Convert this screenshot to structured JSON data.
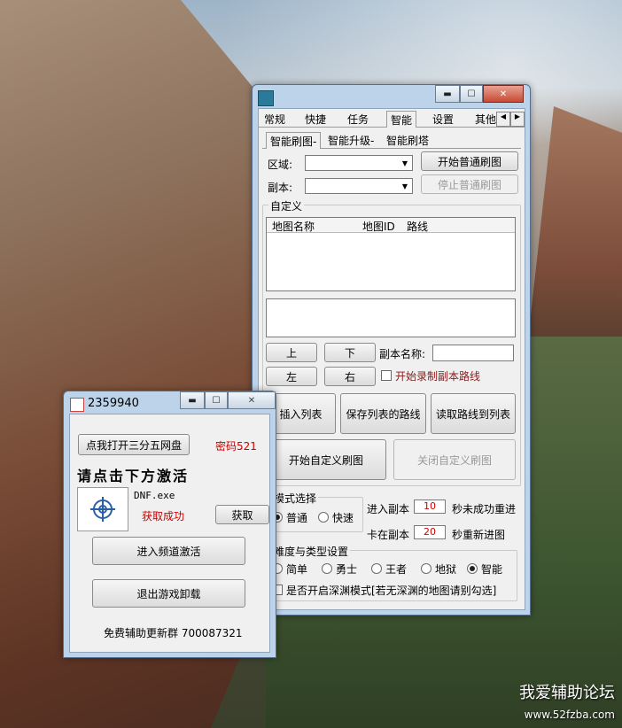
{
  "main": {
    "tabs": [
      "常规",
      "快捷",
      "任务",
      "智能",
      "设置",
      "其他"
    ],
    "subtabs": [
      "智能刷图-",
      "智能升级-",
      "智能刷塔"
    ],
    "region_label": "区域:",
    "dungeon_label": "副本:",
    "start_normal": "开始普通刷图",
    "stop_normal": "停止普通刷图",
    "custom_group": "自定义",
    "list_columns": [
      "地图名称",
      "地图ID",
      "路线"
    ],
    "up": "上",
    "down": "下",
    "left": "左",
    "right": "右",
    "dungeon_name_label": "副本名称:",
    "record_route": "开始录制副本路线",
    "insert_list": "插入列表",
    "save_route": "保存列表的路线",
    "read_route": "读取路线到列表",
    "start_custom": "开始自定义刷图",
    "stop_custom": "关闭自定义刷图",
    "mode_group": "模式选择",
    "mode_normal": "普通",
    "mode_fast": "快速",
    "enter_prefix": "进入副本",
    "enter_value": "10",
    "enter_suffix": "秒未成功重进",
    "stuck_prefix": "卡在副本",
    "stuck_value": "20",
    "stuck_suffix": "秒重新进图",
    "diff_group": "难度与类型设置",
    "diff_options": [
      "简单",
      "勇士",
      "王者",
      "地狱",
      "智能"
    ],
    "abyss_check": "是否开启深渊模式[若无深渊的地图请别勾选]"
  },
  "small": {
    "title": "2359940",
    "open_netdisk": "点我打开三分五网盘",
    "password": "密码521",
    "activate_heading": "请点击下方激活",
    "process_name": "DNF.exe",
    "status": "获取成功",
    "get_button": "获取",
    "enter_channel": "进入频道激活",
    "exit_game": "退出游戏卸载",
    "group_text": "免费辅助更新群 700087321"
  },
  "watermark": {
    "text": "我爱辅助论坛",
    "url": "www.52fzba.com"
  },
  "colors": {
    "accent_red": "#cc0000",
    "titlebar": "#bcd3ea"
  }
}
